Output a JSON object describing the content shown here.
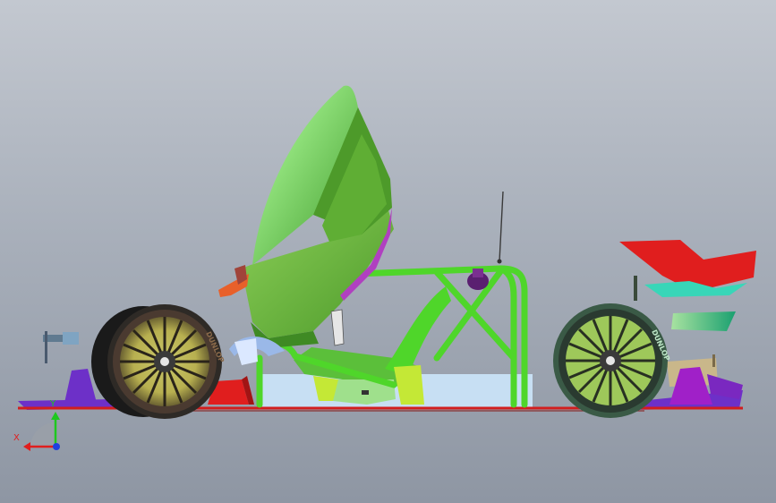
{
  "viewport": {
    "name": "3D model viewport",
    "background": [
      "#c3c8d0",
      "#8e96a3"
    ]
  },
  "model": {
    "tire_branding": "DUNLOP",
    "colors": {
      "body_green": "#5bbf3a",
      "canopy_light": "#9fe08c",
      "frame_green": "#4fd62a",
      "yellow_green": "#c4e836",
      "red": "#e01e1e",
      "purple": "#6d30c8",
      "magenta": "#a020c8",
      "floor_line": "#d21e1e",
      "cyan_fin": "#38d6b8",
      "glass": "#cfeaff"
    }
  },
  "triad": {
    "x_label": "X",
    "y_label": "Y",
    "x_color": "#e01e1e",
    "y_color": "#1ec81e",
    "z_color": "#2040e0"
  }
}
